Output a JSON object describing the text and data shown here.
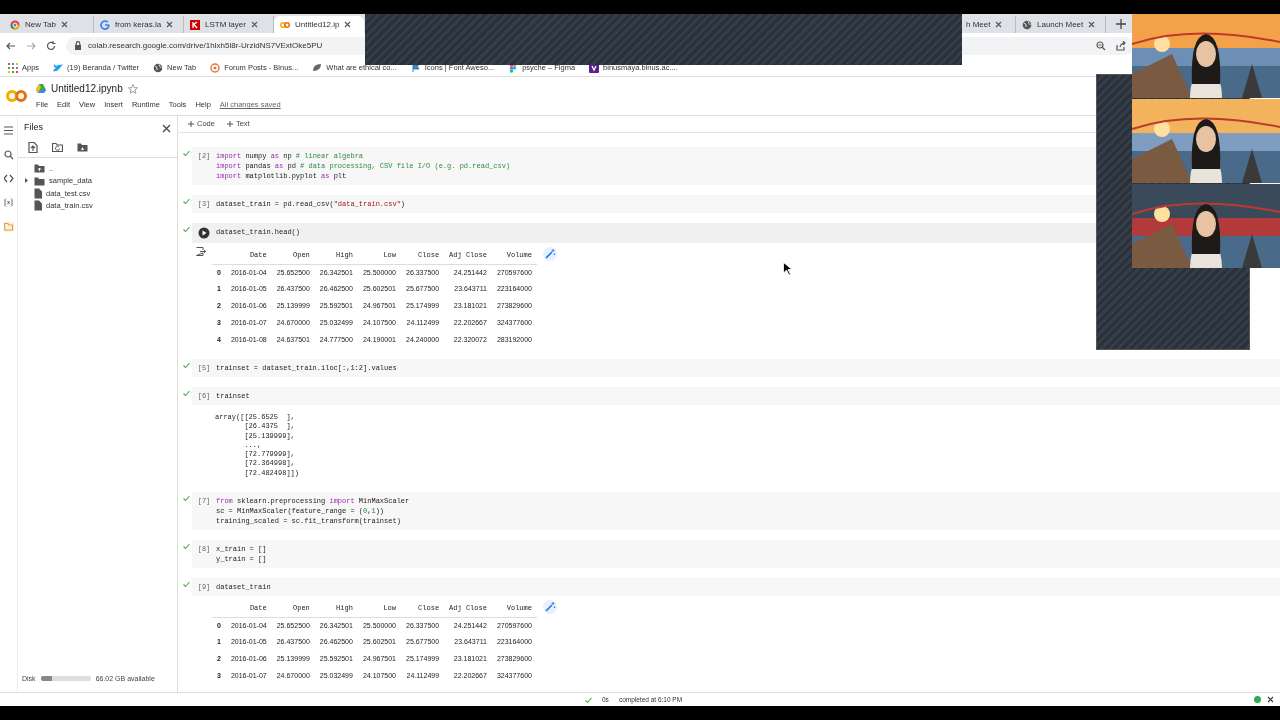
{
  "browser": {
    "tabs": [
      {
        "label": "New Tab",
        "kind": "chrome",
        "selected": false
      },
      {
        "label": "from keras.la",
        "kind": "google",
        "selected": false
      },
      {
        "label": "LSTM layer",
        "kind": "keras",
        "selected": false
      },
      {
        "label": "Untitled12.ip",
        "kind": "colab",
        "selected": true
      },
      {
        "label": "h Meet",
        "kind": "covered",
        "selected": false
      },
      {
        "label": "Launch Meet",
        "kind": "globe",
        "selected": false
      }
    ],
    "address": "colab.research.google.com/drive/1hlxh5l8r-UrzldNS7VExtOke5PU",
    "bookmarks": [
      {
        "label": "Apps",
        "kind": "apps"
      },
      {
        "label": "(19) Beranda / Twitter",
        "kind": "twitter"
      },
      {
        "label": "New Tab",
        "kind": "globe"
      },
      {
        "label": "Forum Posts - Binus...",
        "kind": "forum"
      },
      {
        "label": "What are ethical co...",
        "kind": "leaf"
      },
      {
        "label": "Icons | Font Aweso...",
        "kind": "flag"
      },
      {
        "label": "psyche – Figma",
        "kind": "figma"
      },
      {
        "label": "binusmaya.binus.ac....",
        "kind": "binus"
      }
    ]
  },
  "notebook": {
    "title": "Untitled12.ipynb",
    "menus": [
      "File",
      "Edit",
      "View",
      "Insert",
      "Runtime",
      "Tools",
      "Help"
    ],
    "save_status": "All changes saved",
    "toolbar": [
      "Code",
      "Text"
    ]
  },
  "sidebar": {
    "title": "Files",
    "rail": [
      {
        "kind": "menu",
        "selected": false
      },
      {
        "kind": "search",
        "selected": false
      },
      {
        "kind": "code",
        "selected": false
      },
      {
        "kind": "variables",
        "selected": false
      },
      {
        "kind": "folder",
        "selected": true
      }
    ],
    "tree": [
      {
        "name": "..",
        "kind": "up"
      },
      {
        "name": "sample_data",
        "kind": "folder",
        "expanded": false
      },
      {
        "name": "data_test.csv",
        "kind": "file"
      },
      {
        "name": "data_train.csv",
        "kind": "file"
      }
    ],
    "disk": {
      "label": "Disk",
      "level": 0.22,
      "reading": "66.02 GB available"
    }
  },
  "cells": [
    {
      "count": "[2]",
      "hovered": false,
      "lines": [
        [
          {
            "text": "import",
            "kind": "keyword"
          },
          {
            "text": " numpy ",
            "kind": "plain"
          },
          {
            "text": "as",
            "kind": "keyword"
          },
          {
            "text": " np ",
            "kind": "plain"
          },
          {
            "text": "# linear algebra",
            "kind": "comment"
          }
        ],
        [
          {
            "text": "import",
            "kind": "keyword"
          },
          {
            "text": " pandas ",
            "kind": "plain"
          },
          {
            "text": "as",
            "kind": "keyword"
          },
          {
            "text": " pd ",
            "kind": "plain"
          },
          {
            "text": "# data processing, CSV file I/O (e.g. pd.read_csv)",
            "kind": "comment"
          }
        ],
        [
          {
            "text": "import",
            "kind": "keyword"
          },
          {
            "text": " matplotlib.pyplot ",
            "kind": "plain"
          },
          {
            "text": "as",
            "kind": "keyword"
          },
          {
            "text": " plt",
            "kind": "plain"
          }
        ]
      ]
    },
    {
      "count": "[3]",
      "hovered": false,
      "lines": [
        [
          {
            "text": "dataset_train = pd.read_csv(",
            "kind": "plain"
          },
          {
            "text": "\"data_train.csv\"",
            "kind": "string"
          },
          {
            "text": ")",
            "kind": "plain"
          }
        ]
      ]
    },
    {
      "hovered": true,
      "lines": [
        [
          {
            "text": "dataset_train.head()",
            "kind": "plain"
          }
        ]
      ],
      "output": {
        "kind": "table",
        "columns": [
          "",
          "Date",
          "Open",
          "High",
          "Low",
          "Close",
          "Adj Close",
          "Volume"
        ],
        "rows": [
          [
            "0",
            "2016-01-04",
            "25.652500",
            "26.342501",
            "25.500000",
            "26.337500",
            "24.251442",
            "270597600"
          ],
          [
            "1",
            "2016-01-05",
            "26.437500",
            "26.462500",
            "25.602501",
            "25.677500",
            "23.643711",
            "223164000"
          ],
          [
            "2",
            "2016-01-06",
            "25.139999",
            "25.592501",
            "24.967501",
            "25.174999",
            "23.181021",
            "273829600"
          ],
          [
            "3",
            "2016-01-07",
            "24.670000",
            "25.032499",
            "24.107500",
            "24.112499",
            "22.202667",
            "324377600"
          ],
          [
            "4",
            "2016-01-08",
            "24.637501",
            "24.777500",
            "24.190001",
            "24.240000",
            "22.320072",
            "283192000"
          ]
        ]
      }
    },
    {
      "count": "[5]",
      "hovered": false,
      "lines": [
        [
          {
            "text": "trainset = dataset_train.iloc[:,1:2].values",
            "kind": "plain"
          }
        ]
      ]
    },
    {
      "count": "[6]",
      "hovered": false,
      "lines": [
        [
          {
            "text": "trainset",
            "kind": "plain"
          }
        ]
      ],
      "output": {
        "kind": "text",
        "lines": [
          "array([[25.6525  ],",
          "       [26.4375  ],",
          "       [25.139999],",
          "       ...,",
          "       [72.779999],",
          "       [72.364998],",
          "       [72.482498]])"
        ]
      }
    },
    {
      "count": "[7]",
      "hovered": false,
      "lines": [
        [
          {
            "text": "from",
            "kind": "keyword"
          },
          {
            "text": " sklearn.preprocessing ",
            "kind": "plain"
          },
          {
            "text": "import",
            "kind": "keyword"
          },
          {
            "text": " MinMaxScaler",
            "kind": "plain"
          }
        ],
        [
          {
            "text": "sc = MinMaxScaler(feature_range = (",
            "kind": "plain"
          },
          {
            "text": "0",
            "kind": "number"
          },
          {
            "text": ",",
            "kind": "plain"
          },
          {
            "text": "1",
            "kind": "number"
          },
          {
            "text": "))",
            "kind": "plain"
          }
        ],
        [
          {
            "text": "training_scaled = sc.fit_transform(trainset)",
            "kind": "plain"
          }
        ]
      ]
    },
    {
      "count": "[8]",
      "hovered": false,
      "lines": [
        [
          {
            "text": "x_train = []",
            "kind": "plain"
          }
        ],
        [
          {
            "text": "y_train = []",
            "kind": "plain"
          }
        ]
      ]
    },
    {
      "count": "[9]",
      "hovered": false,
      "lines": [
        [
          {
            "text": "dataset_train",
            "kind": "plain"
          }
        ]
      ],
      "output": {
        "kind": "table",
        "columns": [
          "",
          "Date",
          "Open",
          "High",
          "Low",
          "Close",
          "Adj Close",
          "Volume"
        ],
        "rows": [
          [
            "0",
            "2016-01-04",
            "25.652500",
            "26.342501",
            "25.500000",
            "26.337500",
            "24.251442",
            "270597600"
          ],
          [
            "1",
            "2016-01-05",
            "26.437500",
            "26.462500",
            "25.602501",
            "25.677500",
            "23.643711",
            "223164000"
          ],
          [
            "2",
            "2016-01-06",
            "25.139999",
            "25.592501",
            "24.967501",
            "25.174999",
            "23.181021",
            "273829600"
          ],
          [
            "3",
            "2016-01-07",
            "24.670000",
            "25.032499",
            "24.107500",
            "24.112499",
            "22.202667",
            "324377600"
          ]
        ]
      }
    }
  ],
  "status_bar": {
    "duration": "0s",
    "message": "completed at 6:10 PM",
    "connected": true
  }
}
